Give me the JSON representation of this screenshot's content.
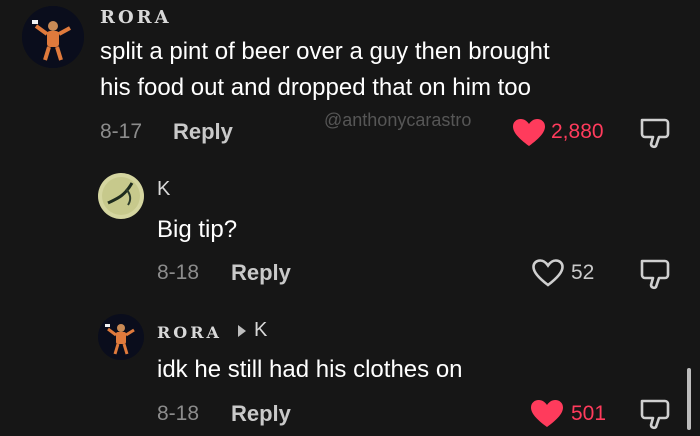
{
  "comments": [
    {
      "username": "RORA",
      "text_line1": "split a pint of beer over a guy then brought",
      "text_line2": "his food out and dropped that on him too",
      "date": "8-17",
      "reply_label": "Reply",
      "likes": "2,880",
      "liked": true
    },
    {
      "username": "K",
      "text": "Big tip?",
      "date": "8-18",
      "reply_label": "Reply",
      "likes": "52",
      "liked": false
    },
    {
      "username": "RORA",
      "reply_to": "K",
      "text": "idk he still had his clothes on",
      "date": "8-18",
      "reply_label": "Reply",
      "likes": "501",
      "liked": true
    }
  ],
  "watermark": "@anthonycarastro",
  "colors": {
    "background": "#161616",
    "liked_heart": "#ff3b5c",
    "text_primary": "#ffffff",
    "text_secondary": "#8c8c8c"
  },
  "icons": [
    "heart-icon",
    "dislike-icon",
    "reply-arrow-icon"
  ]
}
